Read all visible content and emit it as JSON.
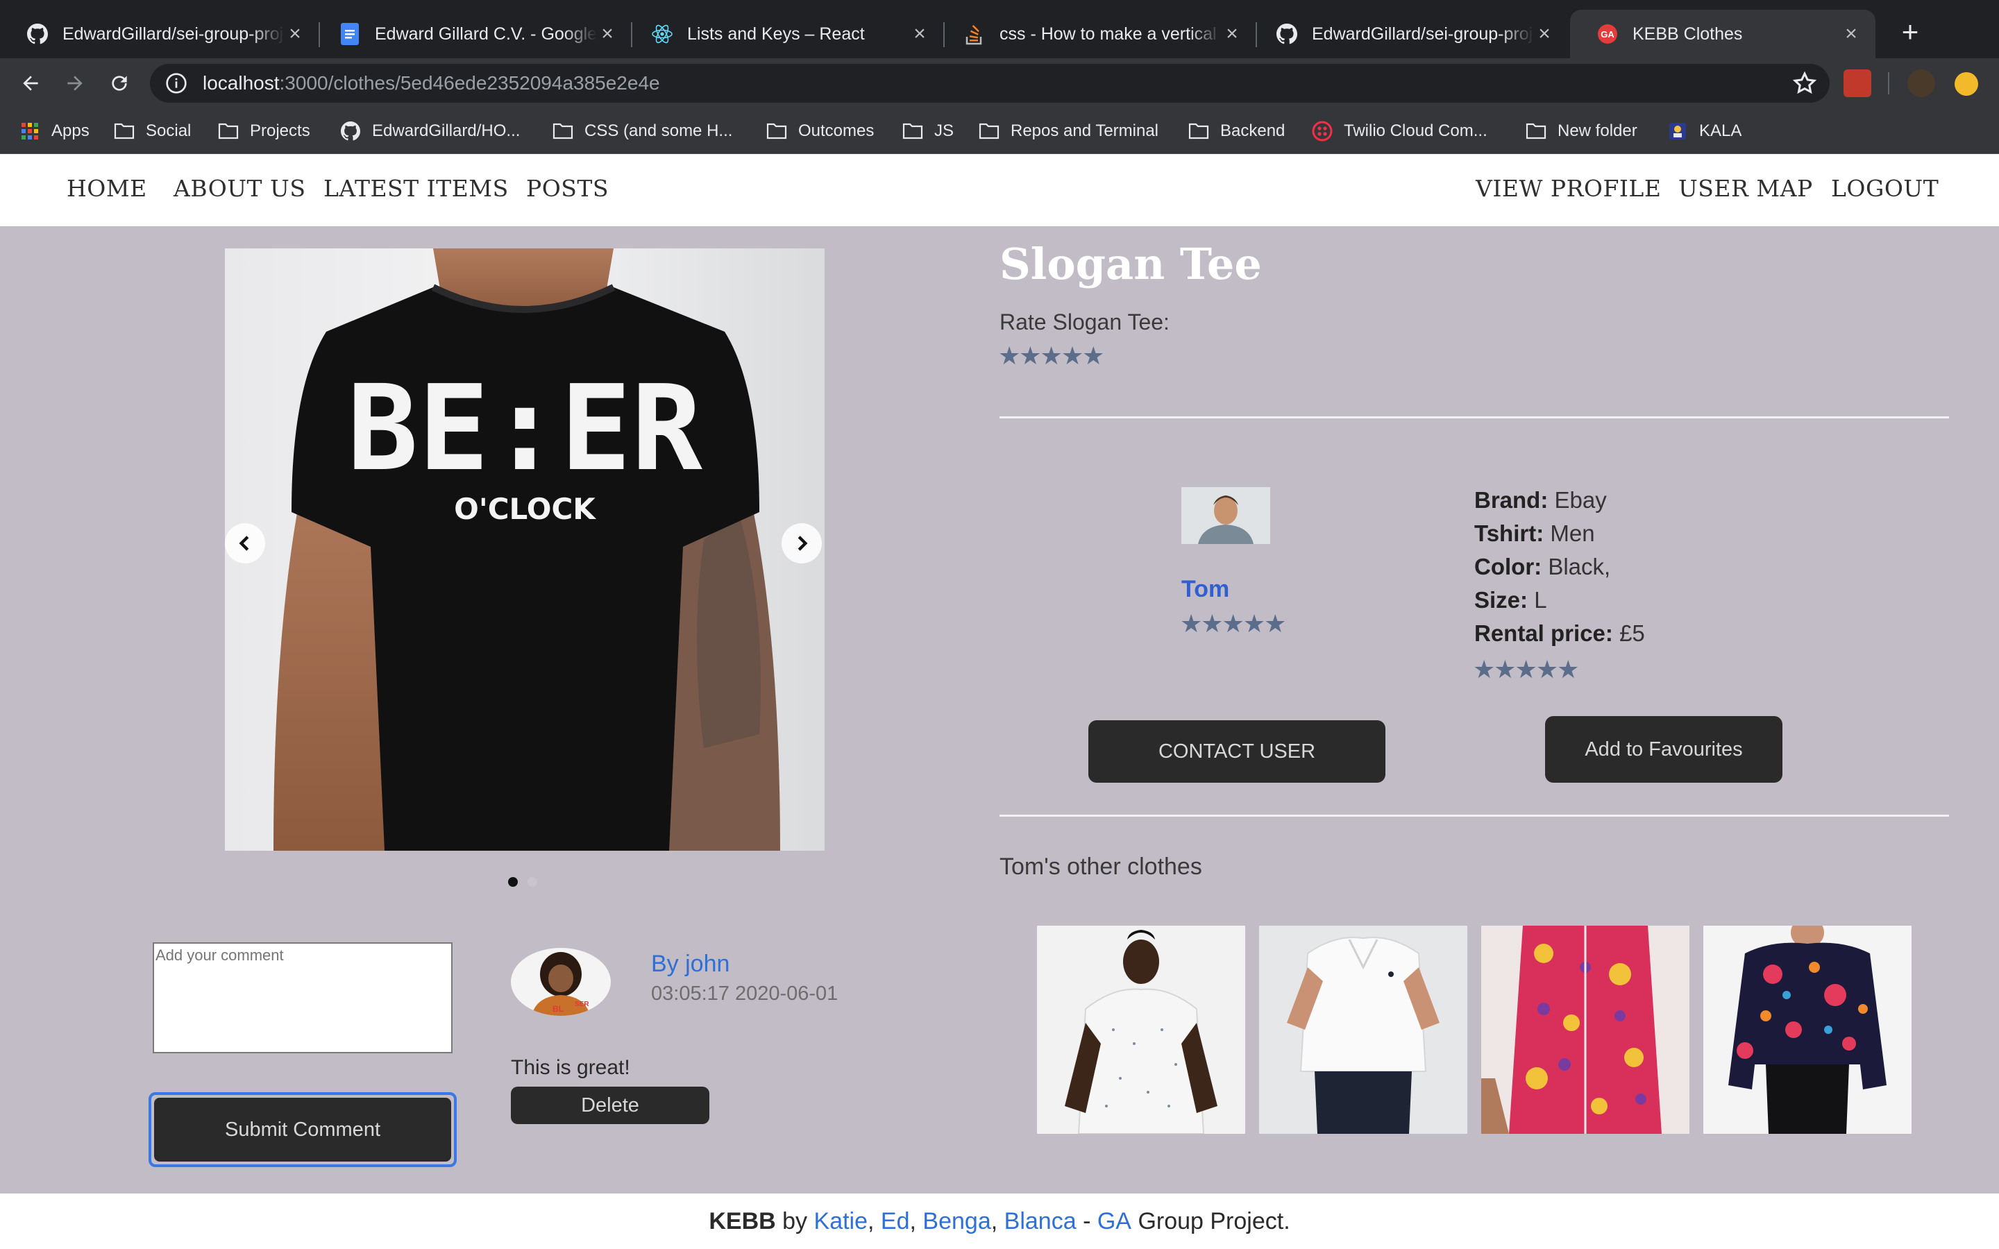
{
  "browser": {
    "tabs": [
      {
        "title": "EdwardGillard/sei-group-project",
        "icon": "github-icon"
      },
      {
        "title": "Edward Gillard C.V. - Google Docs",
        "icon": "google-docs-icon"
      },
      {
        "title": "Lists and Keys – React",
        "icon": "react-icon"
      },
      {
        "title": "css - How to make a vertical line",
        "icon": "stackoverflow-icon"
      },
      {
        "title": "EdwardGillard/sei-group-project",
        "icon": "github-icon"
      },
      {
        "title": "KEBB Clothes",
        "icon": "ga-icon",
        "active": true
      }
    ],
    "url_host": "localhost",
    "url_path": ":3000/clothes/5ed46ede2352094a385e2e4e",
    "bookmarks": [
      {
        "label": "Apps",
        "icon": "apps-grid-icon"
      },
      {
        "label": "Social",
        "icon": "folder-icon"
      },
      {
        "label": "Projects",
        "icon": "folder-icon"
      },
      {
        "label": "EdwardGillard/HO...",
        "icon": "github-icon"
      },
      {
        "label": "CSS (and some H...",
        "icon": "folder-icon"
      },
      {
        "label": "Outcomes",
        "icon": "folder-icon"
      },
      {
        "label": "JS",
        "icon": "folder-icon"
      },
      {
        "label": "Repos and Terminal",
        "icon": "folder-icon"
      },
      {
        "label": "Backend",
        "icon": "folder-icon"
      },
      {
        "label": "Twilio Cloud Com...",
        "icon": "twilio-icon"
      },
      {
        "label": "New folder",
        "icon": "folder-icon"
      },
      {
        "label": "KALA",
        "icon": "kala-icon"
      }
    ]
  },
  "nav": {
    "left": [
      "HOME",
      "ABOUT US",
      "LATEST ITEMS",
      "POSTS"
    ],
    "right": [
      "VIEW PROFILE",
      "USER MAP",
      "LOGOUT"
    ]
  },
  "item": {
    "title": "Slogan Tee",
    "rate_label": "Rate Slogan Tee:",
    "rating_stars": "★★★★★",
    "shirt_print_line1": "BE:ER",
    "shirt_print_line2": "O'CLOCK",
    "carousel_slides": 2,
    "active_slide": 1
  },
  "owner": {
    "name": "Tom",
    "rating_stars": "★★★★★"
  },
  "specs": [
    {
      "label": "Brand:",
      "value": "Ebay"
    },
    {
      "label": "Tshirt:",
      "value": "Men"
    },
    {
      "label": "Color:",
      "value": "Black,"
    },
    {
      "label": "Size:",
      "value": "L"
    },
    {
      "label": "Rental price:",
      "value": "£5"
    }
  ],
  "spec_rating_stars": "★★★★★",
  "buttons": {
    "contact": "CONTACT USER",
    "favourite": "Add to Favourites",
    "submit_comment": "Submit Comment",
    "delete": "Delete"
  },
  "other_clothes": {
    "title": "Tom's other clothes"
  },
  "comment_form": {
    "placeholder": "Add your comment"
  },
  "comment": {
    "author": "By john",
    "time": "03:05:17 2020-06-01",
    "text": "This is great!"
  },
  "footer": {
    "brand": "KEBB",
    "by": "by",
    "authors": [
      "Katie",
      "Ed",
      "Benga",
      "Blanca"
    ],
    "dash": "-",
    "org": "GA",
    "suffix": "Group Project."
  },
  "colors": {
    "page_bg": "#c2bcc6",
    "star": "#5b6d8b",
    "link": "#2f6fd8",
    "button_dark": "#2a2a2a",
    "focus_ring": "#3b78e7"
  }
}
